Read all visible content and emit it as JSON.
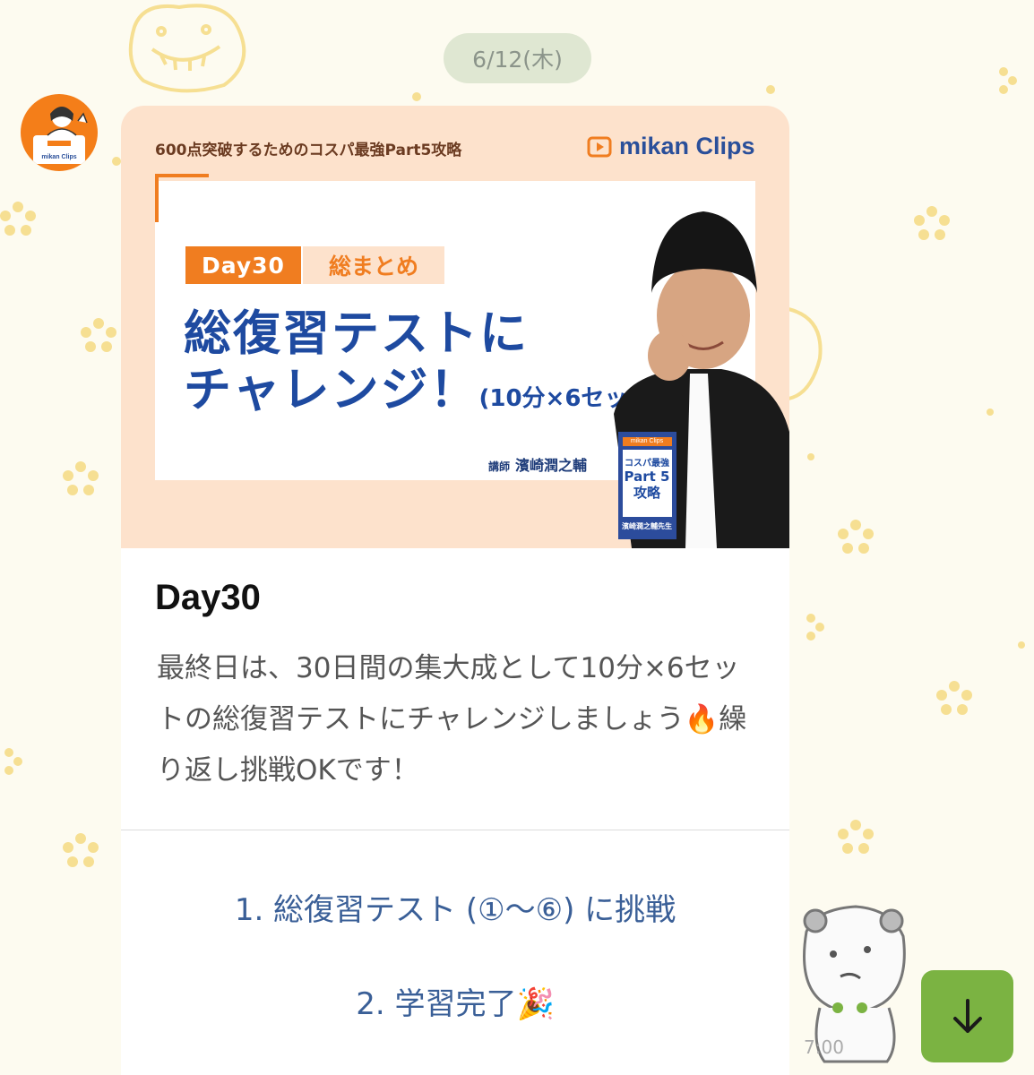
{
  "chat": {
    "date_label": "6/12(木)",
    "time_label": "7:00"
  },
  "avatar": {
    "brand": "mikan Clips"
  },
  "banner": {
    "top_text": "600点突破するためのコスパ最強Part5攻略",
    "logo_text": "mikan Clips",
    "day_badge": "Day30",
    "summary_badge": "総まとめ",
    "headline_line1": "総復習テストに",
    "headline_line2": "チャレンジ！",
    "headline_sub": "(10分×6セット)",
    "lecturer_prefix": "講師",
    "lecturer_name": "濱崎潤之輔",
    "book": {
      "brand": "mikan Clips",
      "line1": "コスパ最強",
      "line2": "Part 5",
      "line3": "攻略",
      "author": "濱崎潤之輔先生"
    }
  },
  "card": {
    "title": "Day30",
    "description": "最終日は、30日間の集大成として10分×6セットの総復習テストにチャレンジしましょう🔥繰り返し挑戦OKです！",
    "actions": [
      {
        "label": "1. 総復習テスト (①～⑥) に挑戦"
      },
      {
        "label": "2. 学習完了🎉"
      }
    ]
  },
  "colors": {
    "accent_orange": "#f07d20",
    "brand_blue": "#1e4aa0",
    "link_blue": "#3a5f97",
    "scroll_button_green": "#7bb342"
  },
  "icons": {
    "scroll_button": "arrow-down-icon"
  }
}
